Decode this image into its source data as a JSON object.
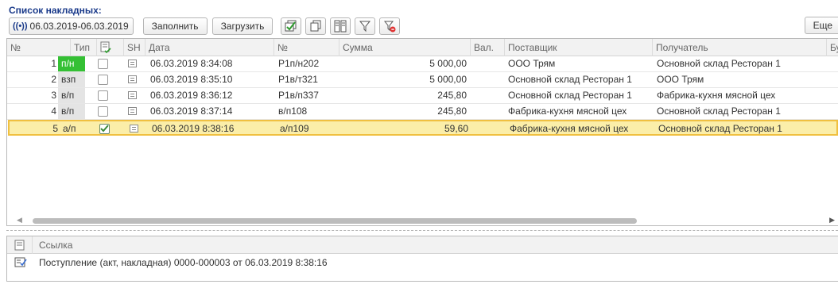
{
  "title": "Список накладных:",
  "toolbar": {
    "period_icon": "((•))",
    "period": "06.03.2019-06.03.2019",
    "fill_label": "Заполнить",
    "load_label": "Загрузить",
    "more_label": "Еще",
    "icons": [
      "check-all-icon",
      "copy-icon",
      "columns-icon",
      "filter-icon",
      "clear-filter-icon"
    ]
  },
  "grid": {
    "headers": {
      "num": "№",
      "type": "Тип",
      "sh": "SH",
      "date": "Дата",
      "docnum": "№",
      "sum": "Сумма",
      "cur": "Вал.",
      "supplier": "Поставщик",
      "receiver": "Получатель",
      "extra": "Бу"
    },
    "rows": [
      {
        "num": "1",
        "type": "п/н",
        "checked": false,
        "date": "06.03.2019 8:34:08",
        "docnum": "Р1п/н202",
        "sum": "5 000,00",
        "supplier": "ООО Трям",
        "receiver": "Основной склад Ресторан 1"
      },
      {
        "num": "2",
        "type": "взп",
        "checked": false,
        "date": "06.03.2019 8:35:10",
        "docnum": "Р1в/т321",
        "sum": "5 000,00",
        "supplier": "Основной склад Ресторан 1",
        "receiver": "ООО Трям"
      },
      {
        "num": "3",
        "type": "в/п",
        "checked": false,
        "date": "06.03.2019 8:36:12",
        "docnum": "Р1в/п337",
        "sum": "245,80",
        "supplier": "Основной склад Ресторан 1",
        "receiver": "Фабрика-кухня мясной цех"
      },
      {
        "num": "4",
        "type": "в/п",
        "checked": false,
        "date": "06.03.2019 8:37:14",
        "docnum": "в/п108",
        "sum": "245,80",
        "supplier": "Фабрика-кухня мясной цех",
        "receiver": "Основной склад Ресторан 1"
      },
      {
        "num": "5",
        "type": "а/п",
        "checked": true,
        "date": "06.03.2019 8:38:16",
        "docnum": "а/п109",
        "sum": "59,60",
        "supplier": "Фабрика-кухня мясной цех",
        "receiver": "Основной склад Ресторан 1"
      }
    ],
    "selected_row": 5
  },
  "sub": {
    "header": "Ссылка",
    "value": "Поступление (акт, накладная) 0000-000003 от 06.03.2019 8:38:16"
  },
  "colors": {
    "title": "#1a3a8a",
    "type_green": "#34c034",
    "selected_bg": "#fbeea9",
    "selected_border": "#f0c040"
  }
}
